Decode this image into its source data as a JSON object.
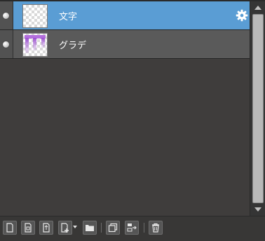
{
  "layers": [
    {
      "name": "文字",
      "selected": true,
      "thumbnail": "checker-transparent",
      "icon": "gear-icon"
    },
    {
      "name": "グラデ",
      "selected": false,
      "thumbnail": "purple-gradient-strokes"
    }
  ],
  "colors": {
    "selected_row": "#5a9dd4",
    "row": "#5a5a5a",
    "panel_bg": "#3f3d3c",
    "gradient_purple": "#a25bd4"
  },
  "toolbar": {
    "icons": [
      "new-layer-icon",
      "new-raster-layer-icon",
      "new-vector-layer-icon",
      "add-layer-dropdown-icon",
      "folder-icon",
      "duplicate-layer-icon",
      "merge-layer-icon",
      "delete-layer-icon"
    ]
  }
}
